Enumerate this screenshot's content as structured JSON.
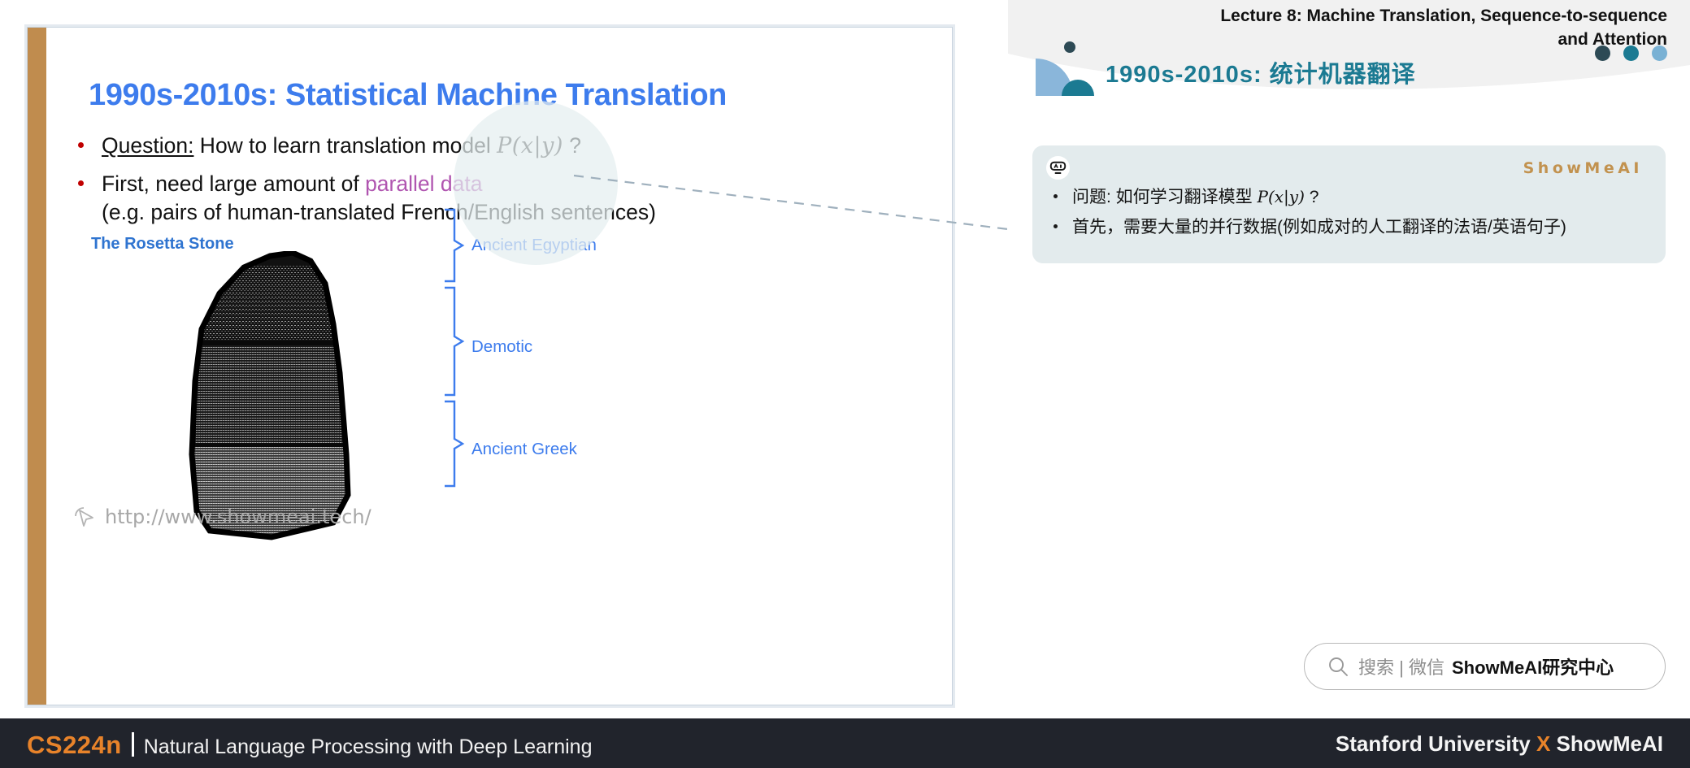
{
  "slide": {
    "title": "1990s-2010s: Statistical Machine Translation",
    "bullets": [
      {
        "prefix": "Question:",
        "text": " How to learn translation model ",
        "math": "P(x|y)",
        "suffix": " ?"
      },
      {
        "line1_before": "First, need large amount of ",
        "line1_highlight": "parallel data",
        "line2": "(e.g. pairs of human-translated French/English sentences)"
      }
    ],
    "image_label": "The Rosetta Stone",
    "brace_labels": [
      "Ancient Egyptian",
      "Demotic",
      "Ancient Greek"
    ],
    "watermark": "http://www.showmeai.tech/",
    "watermark_icon": "cursor-icon",
    "accent_color": "#c08c4e",
    "title_color": "#3d7ced",
    "highlight_color": "#b055b0",
    "bullet_color": "#c00000"
  },
  "right_panel": {
    "lecture_title_line1": "Lecture 8:  Machine Translation, Sequence-to-sequence",
    "lecture_title_line2": "and Attention",
    "cn_title": "1990s-2010s: 统计机器翻译",
    "cn_title_color": "#1b7a92",
    "header_dots": [
      "#2d4a55",
      "#1b7a92",
      "#79b1d4"
    ],
    "deco_icon": "quarter-circle-shape",
    "card": {
      "bot_icon": "ai-robot-icon",
      "logo": "ShowMeAI",
      "logo_color": "#c2924f",
      "bg_color": "#e3ebed",
      "bullets": [
        {
          "text_before": "问题: 如何学习翻译模型 ",
          "math": "P(x|y)",
          "text_after": " ?"
        },
        {
          "text_before": "首先，需要大量的并行数据(例如成对的人工翻译的法语/英语句子)",
          "math": "",
          "text_after": ""
        }
      ]
    },
    "search": {
      "icon": "search-icon",
      "placeholder": "搜索 | 微信",
      "brand": "ShowMeAI研究中心"
    }
  },
  "footer": {
    "course_code": "CS224n",
    "subtitle": "Natural Language Processing with Deep Learning",
    "right_prefix": "Stanford University ",
    "right_x": "X",
    "right_suffix": " ShowMeAI",
    "accent_color": "#e8832a",
    "bg_color": "#21242c"
  }
}
